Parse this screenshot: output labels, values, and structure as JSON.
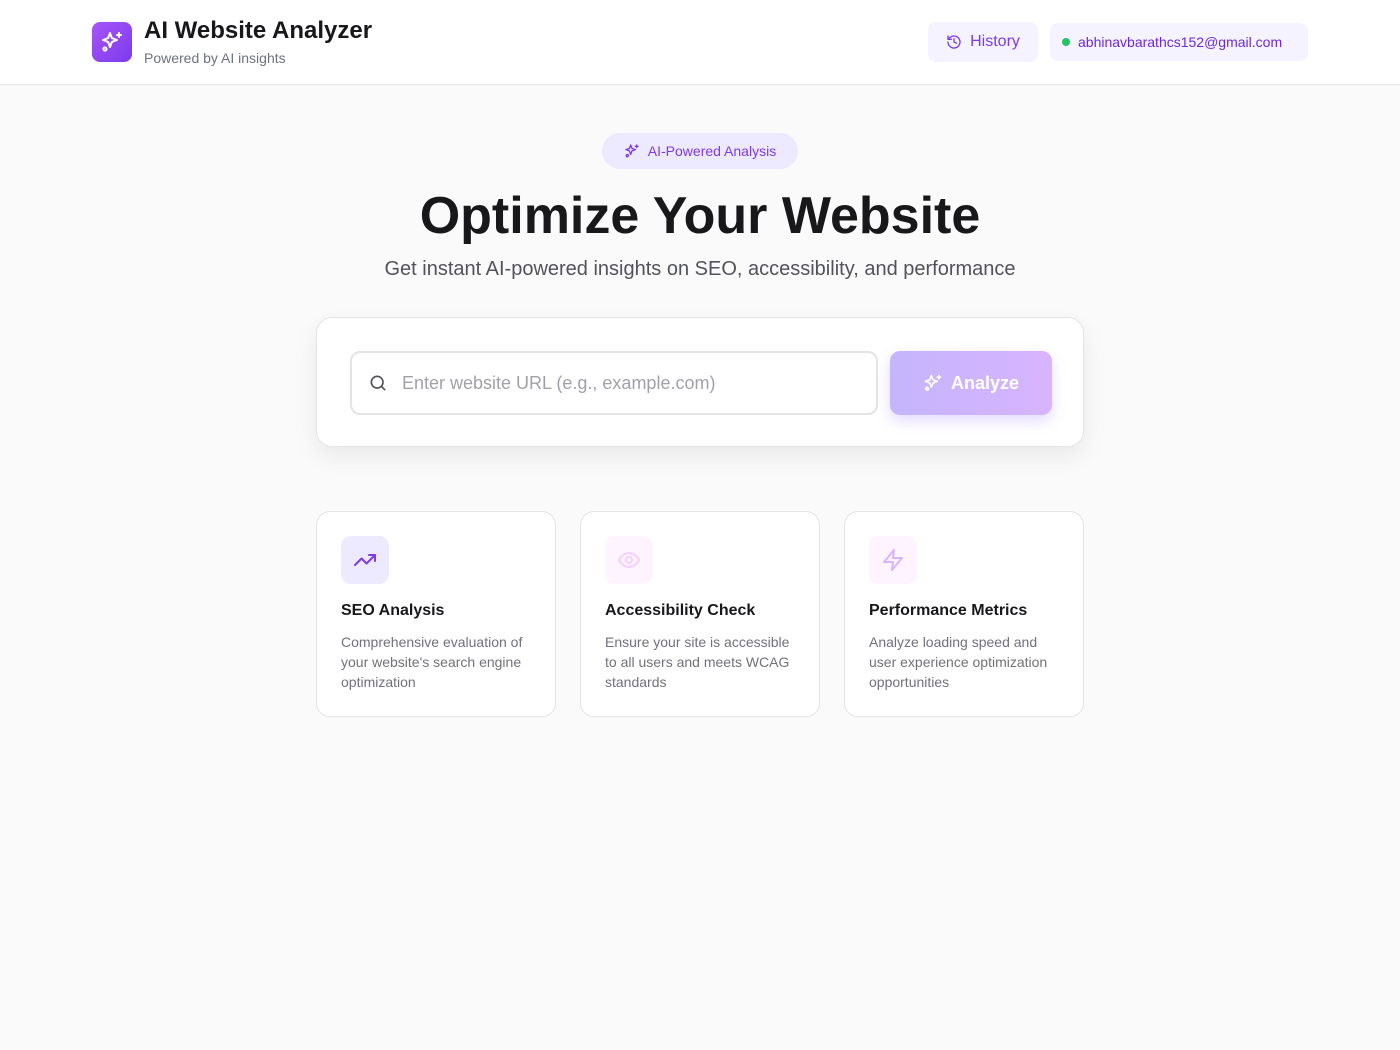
{
  "header": {
    "title": "AI Website Analyzer",
    "subtitle": "Powered by AI insights",
    "logo_icon": "sparkles-icon",
    "history_label": "History",
    "user_email": "abhinavbarathcs152@gmail.com",
    "user_status_color": "#22c55e"
  },
  "hero": {
    "badge": "AI-Powered Analysis",
    "title": "Optimize Your Website",
    "subtitle": "Get instant AI-powered insights on SEO, accessibility, and performance"
  },
  "search": {
    "placeholder": "Enter website URL (e.g., example.com)",
    "value": "",
    "button_label": "Analyze"
  },
  "features": [
    {
      "icon": "trending-up-icon",
      "title": "SEO Analysis",
      "description": "Comprehensive evaluation of your website's search engine optimization"
    },
    {
      "icon": "eye-icon",
      "title": "Accessibility Check",
      "description": "Ensure your site is accessible to all users and meets WCAG standards"
    },
    {
      "icon": "zap-icon",
      "title": "Performance Metrics",
      "description": "Analyze loading speed and user experience optimization opportunities"
    }
  ],
  "colors": {
    "accent": "#8b5cf6",
    "accent_dark": "#7c3aed",
    "background": "#fafafa"
  }
}
